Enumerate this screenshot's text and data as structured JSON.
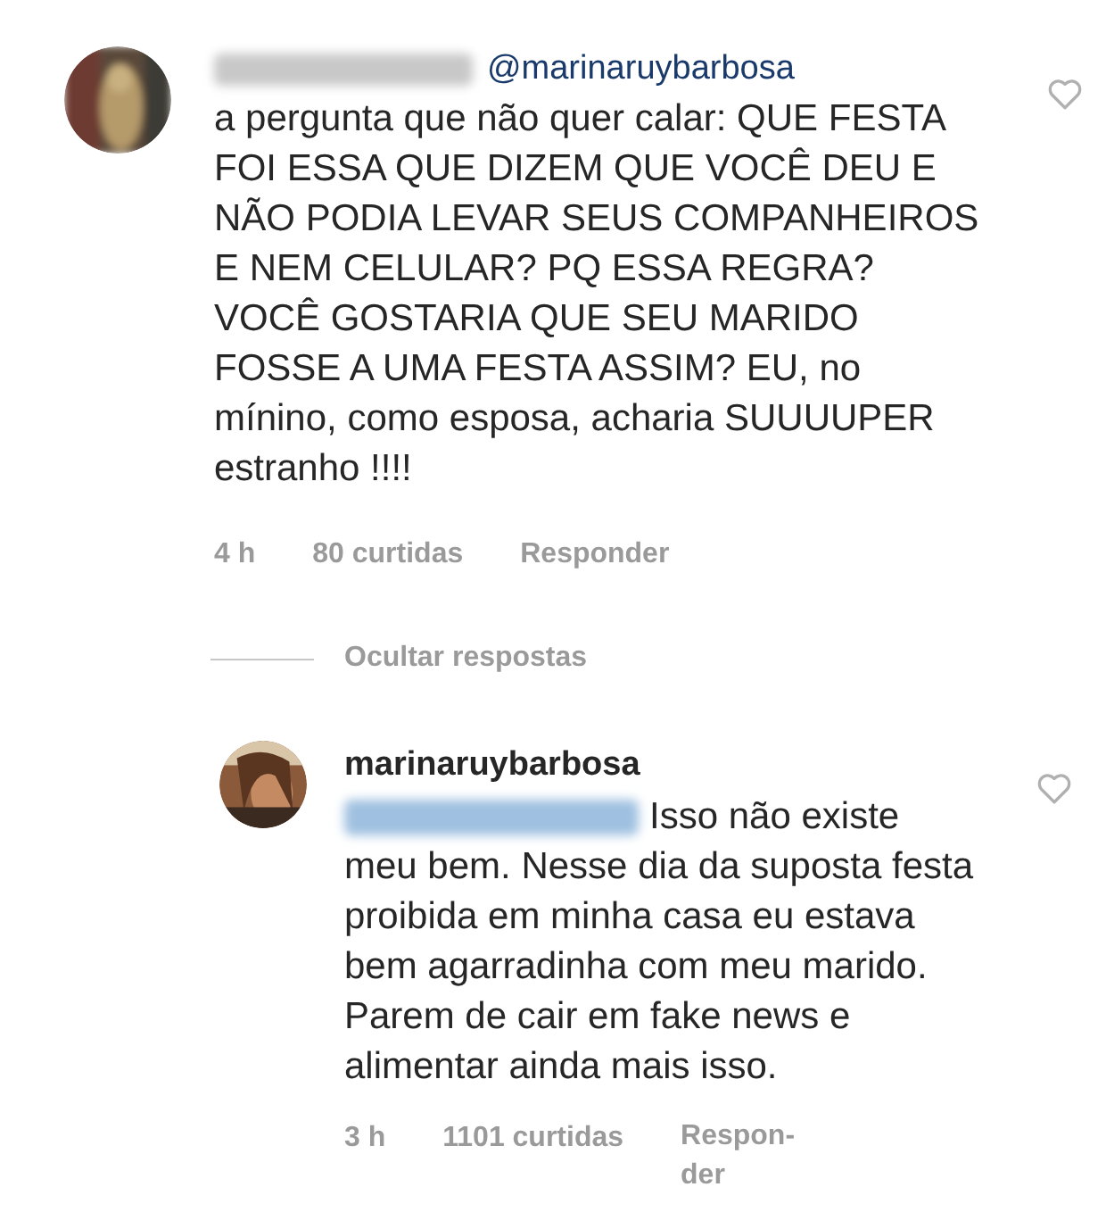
{
  "comment": {
    "mention": "@marinaruybarbosa",
    "text": "a pergunta que não quer calar: QUE FESTA FOI ESSA QUE DIZEM QUE VOCÊ DEU E NÃO PODIA LEVAR SEUS COMPANHEIROS E NEM CELULAR? PQ ESSA REGRA? VOCÊ GOSTARIA QUE SEU MARIDO FOSSE A UMA FESTA ASSIM? EU, no mínino, como esposa, acharia SUUUUPER estranho !!!!",
    "time": "4 h",
    "likes": "80 curtidas",
    "reply_label": "Responder",
    "liked": false
  },
  "hide_replies": "Ocultar respostas",
  "reply": {
    "username": "marinaruybarbosa",
    "text": [
      "Isso não existe",
      "meu bem. Nesse dia da suposta festa proibida em minha casa eu estava bem agarradinha com meu marido. Parem de cair em fake news e alimentar ainda mais isso."
    ],
    "time": "3 h",
    "likes": "1101 curtidas",
    "reply_label": "Respon-der",
    "liked": false
  }
}
